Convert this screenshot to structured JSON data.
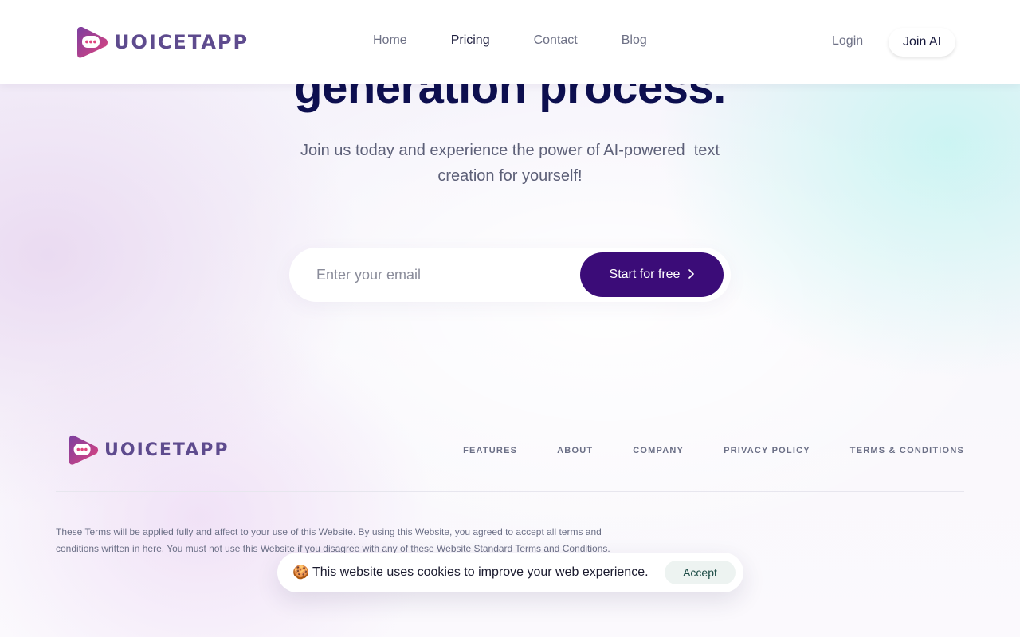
{
  "header": {
    "logo_text": "UOICETAPP",
    "nav": [
      {
        "label": "Home"
      },
      {
        "label": "Pricing"
      },
      {
        "label": "Contact"
      },
      {
        "label": "Blog"
      }
    ],
    "login_label": "Login",
    "join_label": "Join AI"
  },
  "hero": {
    "title_fragment": "generation process.",
    "subtitle": "Join us today and experience the power of AI-powered  text creation for yourself!",
    "email_placeholder": "Enter your email",
    "cta_label": "Start for free",
    "cta_icon": "chevron-right-icon"
  },
  "footer": {
    "logo_text": "UOICETAPP",
    "links": [
      {
        "label": "FEATURES"
      },
      {
        "label": "ABOUT"
      },
      {
        "label": "COMPANY"
      },
      {
        "label": "PRIVACY POLICY"
      },
      {
        "label": "TERMS & CONDITIONS"
      }
    ],
    "terms_text": "These Terms will be applied fully and affect to your use of this Website. By using this Website, you agreed to accept all terms and conditions written in here. You must not use this Website if you disagree with any of these Website Standard Terms and Conditions."
  },
  "cookie_banner": {
    "icon": "cookie-icon",
    "text": "This website uses cookies to improve your web experience.",
    "accept_label": "Accept"
  },
  "colors": {
    "brand_purple": "#3b0c78",
    "title_navy": "#0d0f4f",
    "logo_gradient_start": "#7b3fa0",
    "logo_gradient_end": "#e0447e"
  }
}
